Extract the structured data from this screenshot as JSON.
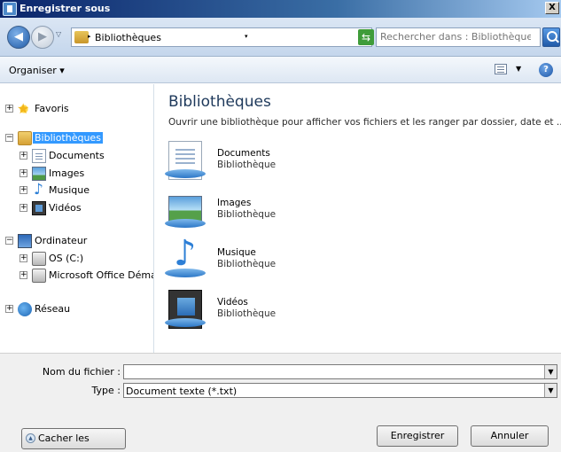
{
  "window": {
    "title": "Enregistrer sous",
    "close_glyph": "X"
  },
  "nav": {
    "back_glyph": "◀",
    "forward_glyph": "▶",
    "address_crumb": "Bibliothèques",
    "search_placeholder": "Rechercher dans : Bibliothèques"
  },
  "toolbar": {
    "organize_label": "Organiser ▾",
    "help_glyph": "?"
  },
  "sidebar": {
    "items": [
      {
        "label": "Favoris",
        "icon": "star-icon",
        "expander": "+"
      },
      {
        "label": "Bibliothèques",
        "icon": "library-icon",
        "expander": "−",
        "selected": true
      },
      {
        "label": "Documents",
        "icon": "document-icon",
        "expander": "+"
      },
      {
        "label": "Images",
        "icon": "image-icon",
        "expander": "+"
      },
      {
        "label": "Musique",
        "icon": "music-icon",
        "expander": "+"
      },
      {
        "label": "Vidéos",
        "icon": "video-icon",
        "expander": "+"
      },
      {
        "label": "Ordinateur",
        "icon": "computer-icon",
        "expander": "−"
      },
      {
        "label": "OS (C:)",
        "icon": "drive-icon",
        "expander": "+"
      },
      {
        "label": "Microsoft Office Déma",
        "icon": "drive-icon",
        "expander": "+"
      },
      {
        "label": "Réseau",
        "icon": "network-icon",
        "expander": "+"
      }
    ]
  },
  "main": {
    "title": "Bibliothèques",
    "subtitle": "Ouvrir une bibliothèque pour afficher vos fichiers et les ranger par dossier, date et ...",
    "libraries": [
      {
        "name": "Documents",
        "kind": "Bibliothèque",
        "icon": "documents-library-icon"
      },
      {
        "name": "Images",
        "kind": "Bibliothèque",
        "icon": "images-library-icon"
      },
      {
        "name": "Musique",
        "kind": "Bibliothèque",
        "icon": "music-library-icon"
      },
      {
        "name": "Vidéos",
        "kind": "Bibliothèque",
        "icon": "videos-library-icon"
      }
    ]
  },
  "form": {
    "filename_label": "Nom du fichier :",
    "filename_value": "",
    "type_label": "Type :",
    "type_value": "Document texte (*.txt)",
    "dropdown_glyph": "▼"
  },
  "buttons": {
    "hide_folders": "Cacher les dossiers",
    "hide_glyph": "▲",
    "save": "Enregistrer",
    "cancel": "Annuler"
  }
}
